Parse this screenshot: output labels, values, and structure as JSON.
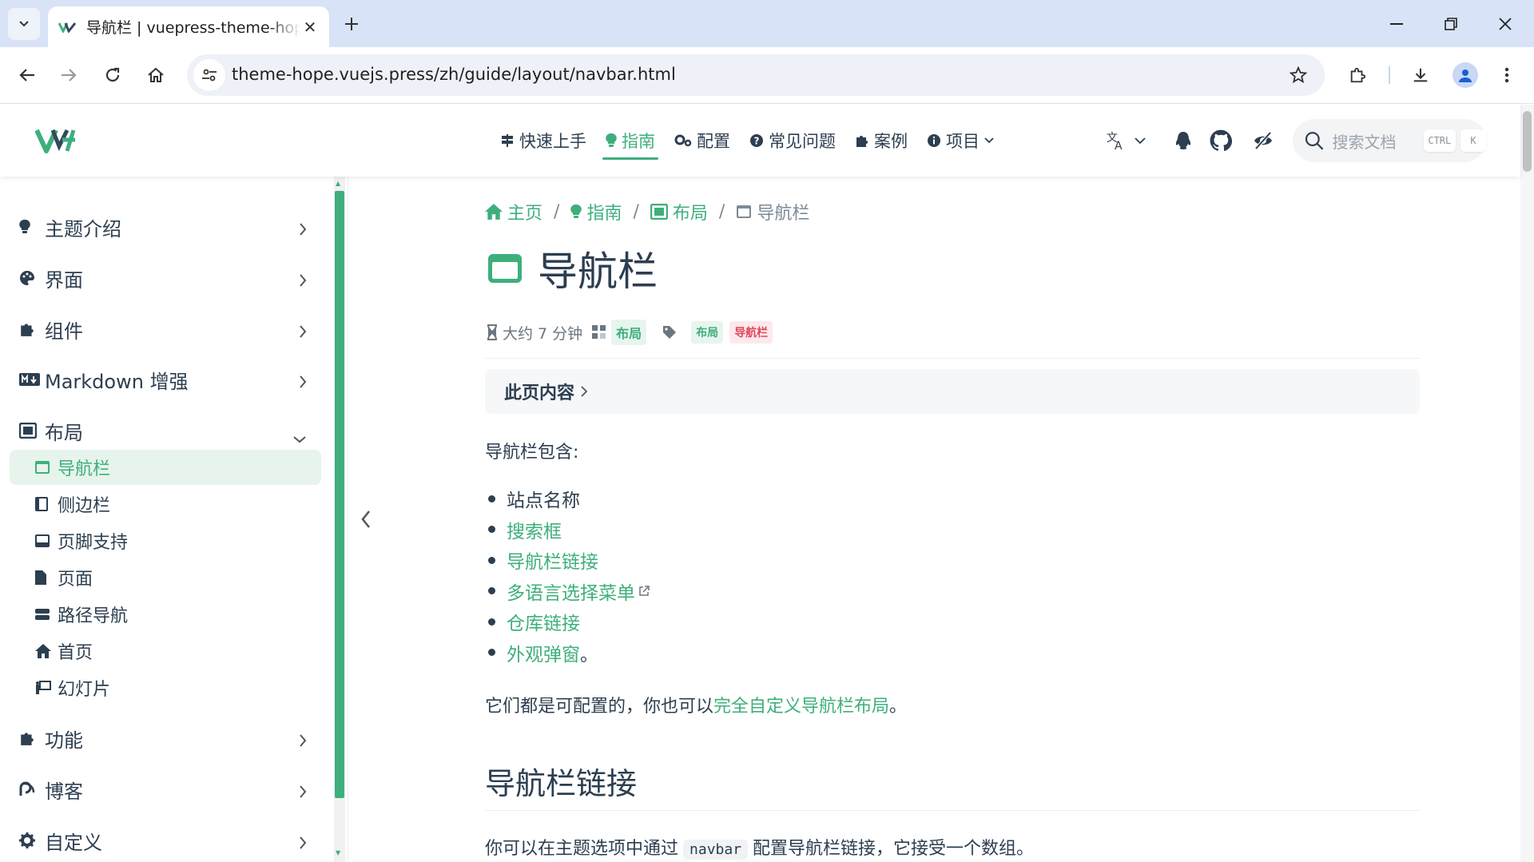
{
  "browser": {
    "tab_title": "导航栏 | vuepress-theme-hope",
    "url": "theme-hope.vuejs.press/zh/guide/layout/navbar.html"
  },
  "site_nav": {
    "links": [
      {
        "label": "快速上手",
        "icon": "signs-icon"
      },
      {
        "label": "指南",
        "icon": "lightbulb-icon",
        "active": true
      },
      {
        "label": "配置",
        "icon": "gears-icon"
      },
      {
        "label": "常见问题",
        "icon": "question-circle-icon"
      },
      {
        "label": "案例",
        "icon": "puzzle-icon"
      },
      {
        "label": "项目",
        "icon": "info-circle-icon",
        "dropdown": true
      }
    ],
    "search_placeholder": "搜索文档",
    "search_kbd_1": "CTRL",
    "search_kbd_2": "K"
  },
  "sidebar": {
    "groups": [
      {
        "label": "主题介绍",
        "icon": "lightbulb-icon"
      },
      {
        "label": "界面",
        "icon": "palette-icon"
      },
      {
        "label": "组件",
        "icon": "puzzle-icon"
      },
      {
        "label": "Markdown 增强",
        "icon": "markdown-icon"
      },
      {
        "label": "布局",
        "icon": "layout-icon",
        "expanded": true
      },
      {
        "label": "功能",
        "icon": "puzzle-icon"
      },
      {
        "label": "博客",
        "icon": "blog-icon"
      },
      {
        "label": "自定义",
        "icon": "gear-icon"
      }
    ],
    "layout_children": [
      {
        "label": "导航栏",
        "icon": "window-icon",
        "active": true
      },
      {
        "label": "侧边栏",
        "icon": "sidebar-icon"
      },
      {
        "label": "页脚支持",
        "icon": "footer-icon"
      },
      {
        "label": "页面",
        "icon": "file-icon"
      },
      {
        "label": "路径导航",
        "icon": "ellipsis-icon"
      },
      {
        "label": "首页",
        "icon": "home-icon"
      },
      {
        "label": "幻灯片",
        "icon": "slides-icon"
      }
    ]
  },
  "breadcrumb": [
    {
      "label": "主页",
      "icon": "home-icon"
    },
    {
      "label": "指南",
      "icon": "lightbulb-icon"
    },
    {
      "label": "布局",
      "icon": "layout-icon"
    },
    {
      "label": "导航栏",
      "icon": "window-icon"
    }
  ],
  "page": {
    "title": "导航栏",
    "reading_time": "大约 7 分钟",
    "category": "布局",
    "tags": [
      "布局",
      "导航栏"
    ],
    "toc_label": "此页内容",
    "intro": "导航栏包含:",
    "list": [
      {
        "text": "站点名称",
        "link": false
      },
      {
        "text": "搜索框",
        "link": true
      },
      {
        "text": "导航栏链接",
        "link": true
      },
      {
        "text": "多语言选择菜单",
        "link": true,
        "external": true
      },
      {
        "text": "仓库链接",
        "link": true
      },
      {
        "text": "外观弹窗",
        "link": true,
        "suffix": "。"
      }
    ],
    "para_prefix": "它们都是可配置的，你也可以",
    "para_link": "完全自定义导航栏布局",
    "para_suffix": "。",
    "h2": "导航栏链接",
    "p2_prefix": "你可以在主题选项中通过",
    "p2_code": "navbar",
    "p2_suffix": "配置导航栏链接，它接受一个数组。"
  },
  "colors": {
    "accent": "#3eaf7c",
    "text": "#2c3e50",
    "tab_bar": "#d8e3f7",
    "tag_red": "#e0475b"
  }
}
